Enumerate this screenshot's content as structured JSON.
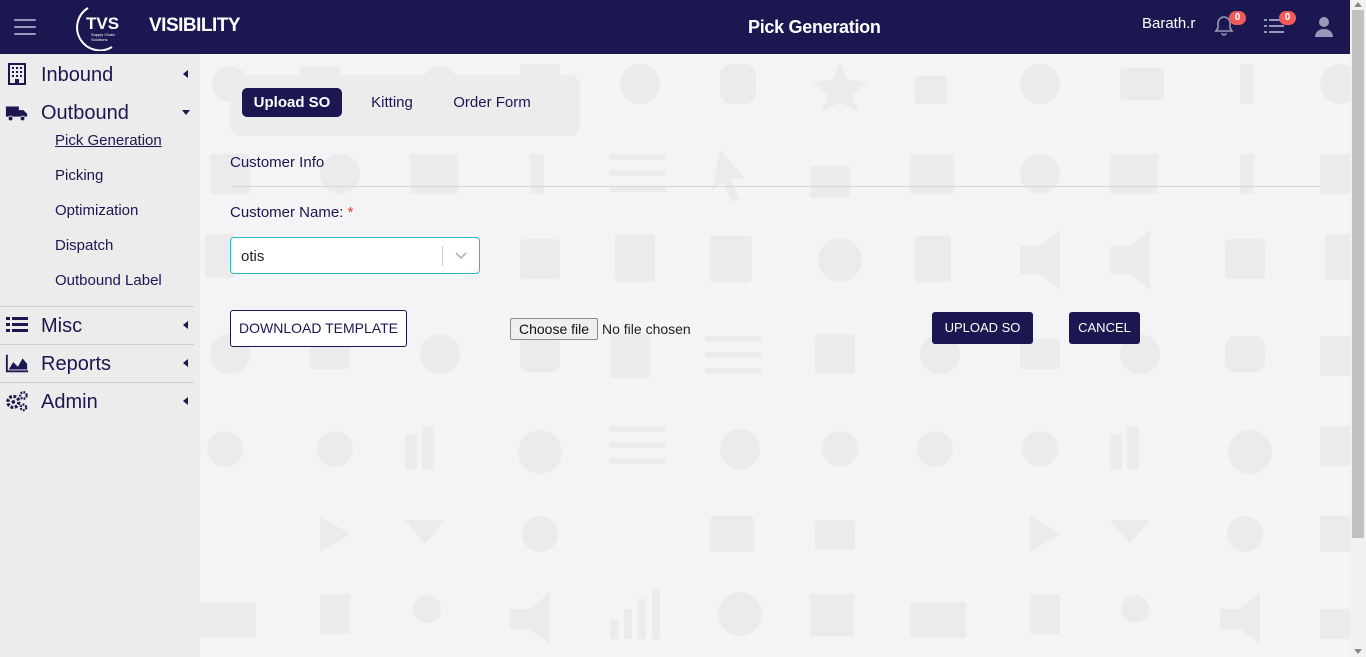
{
  "header": {
    "brand": "VISIBILITY",
    "logo_text": "TVS",
    "logo_subtext": "Supply Chain Solutions",
    "page_title": "Pick Generation",
    "username": "Barath.r",
    "notifications_count": "0",
    "tasks_count": "0"
  },
  "sidebar": {
    "groups": [
      {
        "label": "Inbound",
        "icon": "building-icon",
        "expanded": false
      },
      {
        "label": "Outbound",
        "icon": "truck-icon",
        "expanded": true
      },
      {
        "label": "Misc",
        "icon": "list-icon",
        "expanded": false
      },
      {
        "label": "Reports",
        "icon": "area-chart-icon",
        "expanded": false
      },
      {
        "label": "Admin",
        "icon": "gears-icon",
        "expanded": false
      }
    ],
    "outbound_items": [
      {
        "label": "Pick Generation",
        "active": true
      },
      {
        "label": "Picking"
      },
      {
        "label": "Optimization"
      },
      {
        "label": "Dispatch"
      },
      {
        "label": "Outbound Label"
      }
    ]
  },
  "main": {
    "tabs": [
      {
        "label": "Upload SO",
        "active": true
      },
      {
        "label": "Kitting"
      },
      {
        "label": "Order Form"
      }
    ],
    "section_title": "Customer Info",
    "customer_label": "Customer Name:",
    "required_mark": "*",
    "customer_value": "otis",
    "download_template_label": "DOWNLOAD TEMPLATE",
    "choose_file_label": "Choose file",
    "file_status": "No file chosen",
    "upload_so_label": "UPLOAD SO",
    "cancel_label": "CANCEL"
  },
  "colors": {
    "primary": "#1b1750",
    "accent_border": "#2fb6c9",
    "badge": "#ef5a5a",
    "required": "#e03b3b"
  }
}
